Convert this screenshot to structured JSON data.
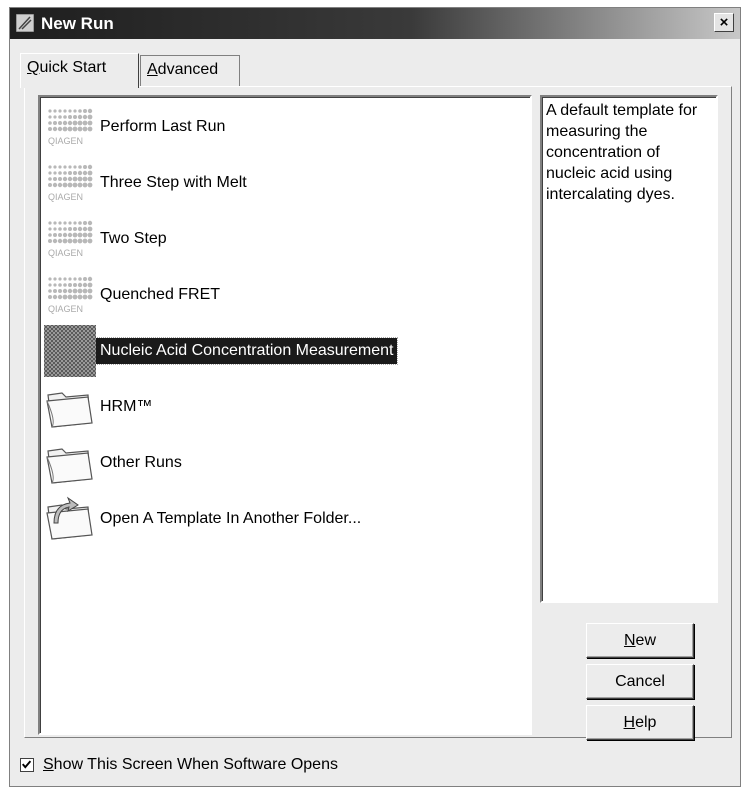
{
  "window": {
    "title": "New Run",
    "close_label": "×"
  },
  "tabs": [
    {
      "label": "Quick Start",
      "accel": "Q",
      "rest": "uick Start",
      "active": true
    },
    {
      "label": "Advanced",
      "accel": "A",
      "rest": "dvanced",
      "active": false
    }
  ],
  "templates": [
    {
      "label": "Perform Last Run",
      "icon": "qiagen-logo-icon"
    },
    {
      "label": "Three Step with Melt",
      "icon": "qiagen-logo-icon"
    },
    {
      "label": "Two Step",
      "icon": "qiagen-logo-icon"
    },
    {
      "label": "Quenched FRET",
      "icon": "qiagen-logo-icon"
    },
    {
      "label": "Nucleic Acid Concentration Measurement",
      "icon": "qiagen-logo-icon",
      "selected": true
    },
    {
      "label": "HRM™",
      "icon": "folder-icon"
    },
    {
      "label": "Other Runs",
      "icon": "folder-icon"
    },
    {
      "label": "Open A Template In Another Folder...",
      "icon": "open-folder-icon"
    }
  ],
  "description": "A default template for measuring the concentration of nucleic acid using intercalating dyes.",
  "buttons": {
    "new": {
      "accel": "N",
      "rest": "ew"
    },
    "cancel": {
      "label": "Cancel"
    },
    "help": {
      "accel": "H",
      "rest": "elp"
    }
  },
  "footer": {
    "show_screen_accel": "S",
    "show_screen_rest": "how This Screen When Software Opens",
    "checked": true
  },
  "icon_text": "QIAGEN"
}
